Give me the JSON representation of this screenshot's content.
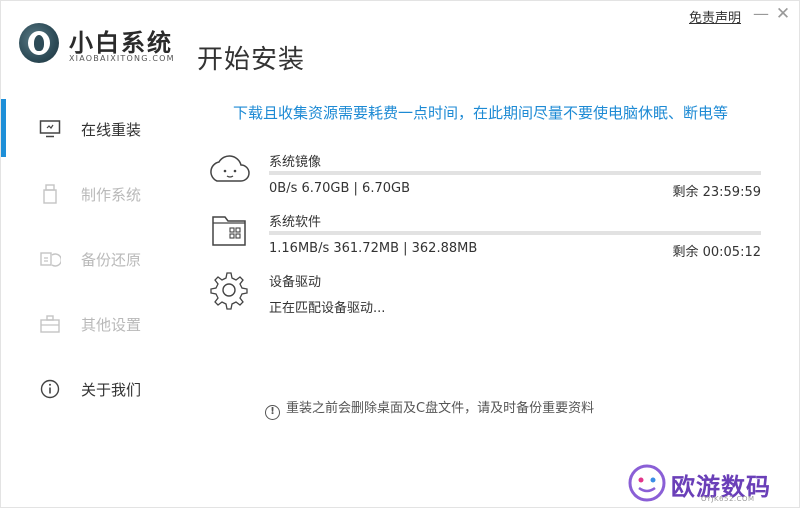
{
  "app": {
    "brand_name": "小白系统",
    "brand_sub": "XIAOBAIXITONG.COM",
    "page_title": "开始安装",
    "disclaimer": "免责声明",
    "min_glyph": "—",
    "close_glyph": "✕"
  },
  "sidebar": {
    "items": [
      {
        "label": "在线重装",
        "icon": "monitor-icon",
        "active": true
      },
      {
        "label": "制作系统",
        "icon": "usb-icon",
        "active": false
      },
      {
        "label": "备份还原",
        "icon": "backup-icon",
        "active": false
      },
      {
        "label": "其他设置",
        "icon": "briefcase-icon",
        "active": false
      },
      {
        "label": "关于我们",
        "icon": "info-icon",
        "active": false
      }
    ]
  },
  "main": {
    "notice": "下载且收集资源需要耗费一点时间，在此期间尽量不要使电脑休眠、断电等",
    "tasks": [
      {
        "title": "系统镜像",
        "stat": "0B/s 6.70GB | 6.70GB",
        "remain": "剩余 23:59:59",
        "icon": "cloud-face-icon",
        "progress": 0
      },
      {
        "title": "系统软件",
        "stat": "1.16MB/s 361.72MB | 362.88MB",
        "remain": "剩余 00:05:12",
        "icon": "folder-apps-icon",
        "progress": 0
      },
      {
        "title": "设备驱动",
        "stat": "正在匹配设备驱动...",
        "remain": "",
        "icon": "gear-icon",
        "progress": 0
      }
    ],
    "warning": "重装之前会删除桌面及C盘文件，请及时备份重要资料",
    "warning_icon_glyph": "!"
  },
  "watermark": {
    "text": "欧游数码",
    "sub": "OYJK652.COM"
  },
  "colors": {
    "accent": "#1e8fd8",
    "notice": "#1d8ad4",
    "dim": "#b9b9b9"
  }
}
